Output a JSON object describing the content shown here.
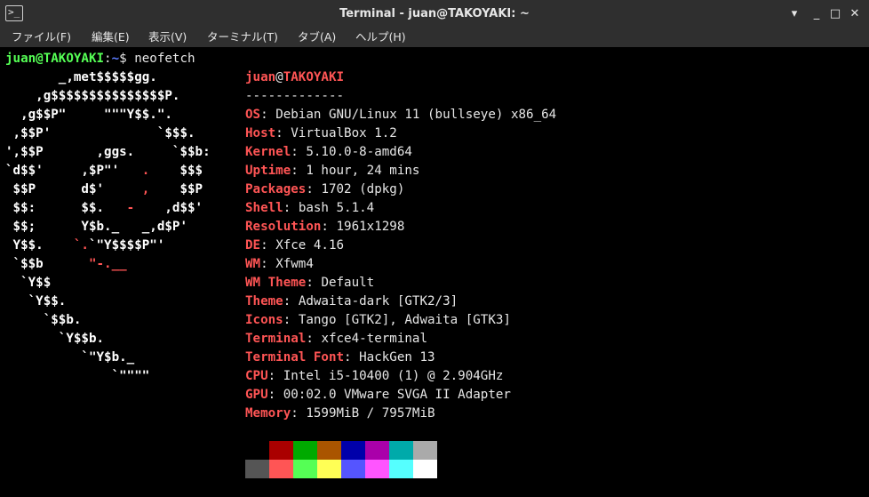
{
  "window": {
    "title": "Terminal - juan@TAKOYAKI: ~",
    "app_icon_glyph": ">_",
    "controls": {
      "minimize": "_",
      "maximize": "□",
      "close": "✕",
      "menu": "▾"
    }
  },
  "menubar": {
    "items": [
      "ファイル(F)",
      "編集(E)",
      "表示(V)",
      "ターミナル(T)",
      "タブ(A)",
      "ヘルプ(H)"
    ]
  },
  "prompt": {
    "user_host": "juan@TAKOYAKI",
    "colon": ":",
    "path": "~",
    "symbol": "$",
    "command": " neofetch"
  },
  "ascii_art": [
    [
      {
        "t": "       _,met$$$$$gg.",
        "c": "w"
      }
    ],
    [
      {
        "t": "    ,g$$$$$$$$$$$$$$$P.",
        "c": "w"
      }
    ],
    [
      {
        "t": "  ,g$$P\"     \"\"\"Y$$.\".",
        "c": "w"
      }
    ],
    [
      {
        "t": " ,$$P'              `$$$.",
        "c": "w"
      }
    ],
    [
      {
        "t": "',$$P       ,ggs.     `$$b:",
        "c": "w"
      }
    ],
    [
      {
        "t": "`d$$'     ,$P\"'   ",
        "c": "w"
      },
      {
        "t": ".",
        "c": "r"
      },
      {
        "t": "    $$$",
        "c": "w"
      }
    ],
    [
      {
        "t": " $$P      d$'     ",
        "c": "w"
      },
      {
        "t": ",",
        "c": "r"
      },
      {
        "t": "    $$P",
        "c": "w"
      }
    ],
    [
      {
        "t": " $$:      $$.   ",
        "c": "w"
      },
      {
        "t": "-",
        "c": "r"
      },
      {
        "t": "    ,d$$'",
        "c": "w"
      }
    ],
    [
      {
        "t": " $$;      Y$b._   _,d$P'",
        "c": "w"
      }
    ],
    [
      {
        "t": " Y$$.    ",
        "c": "w"
      },
      {
        "t": "`.",
        "c": "r"
      },
      {
        "t": "`\"Y$$$$P\"'",
        "c": "w"
      }
    ],
    [
      {
        "t": " `$$b      ",
        "c": "w"
      },
      {
        "t": "\"-.__",
        "c": "r"
      }
    ],
    [
      {
        "t": "  `Y$$",
        "c": "w"
      }
    ],
    [
      {
        "t": "   `Y$$.",
        "c": "w"
      }
    ],
    [
      {
        "t": "     `$$b.",
        "c": "w"
      }
    ],
    [
      {
        "t": "       `Y$$b.",
        "c": "w"
      }
    ],
    [
      {
        "t": "          `\"Y$b._",
        "c": "w"
      }
    ],
    [
      {
        "t": "              `\"\"\"\"",
        "c": "w"
      }
    ]
  ],
  "info": {
    "user": "juan",
    "at": "@",
    "host": "TAKOYAKI",
    "separator": "-------------",
    "fields": [
      {
        "key": "OS",
        "value": "Debian GNU/Linux 11 (bullseye) x86_64"
      },
      {
        "key": "Host",
        "value": "VirtualBox 1.2"
      },
      {
        "key": "Kernel",
        "value": "5.10.0-8-amd64"
      },
      {
        "key": "Uptime",
        "value": "1 hour, 24 mins"
      },
      {
        "key": "Packages",
        "value": "1702 (dpkg)"
      },
      {
        "key": "Shell",
        "value": "bash 5.1.4"
      },
      {
        "key": "Resolution",
        "value": "1961x1298"
      },
      {
        "key": "DE",
        "value": "Xfce 4.16"
      },
      {
        "key": "WM",
        "value": "Xfwm4"
      },
      {
        "key": "WM Theme",
        "value": "Default"
      },
      {
        "key": "Theme",
        "value": "Adwaita-dark [GTK2/3]"
      },
      {
        "key": "Icons",
        "value": "Tango [GTK2], Adwaita [GTK3]"
      },
      {
        "key": "Terminal",
        "value": "xfce4-terminal"
      },
      {
        "key": "Terminal Font",
        "value": "HackGen 13"
      },
      {
        "key": "CPU",
        "value": "Intel i5-10400 (1) @ 2.904GHz"
      },
      {
        "key": "GPU",
        "value": "00:02.0 VMware SVGA II Adapter"
      },
      {
        "key": "Memory",
        "value": "1599MiB / 7957MiB"
      }
    ]
  },
  "palette": {
    "row1": [
      "#000000",
      "#aa0000",
      "#00aa00",
      "#aa5500",
      "#0000aa",
      "#aa00aa",
      "#00aaaa",
      "#aaaaaa"
    ],
    "row2": [
      "#555555",
      "#ff5555",
      "#55ff55",
      "#ffff55",
      "#5555ff",
      "#ff55ff",
      "#55ffff",
      "#ffffff"
    ]
  },
  "colors": {
    "accent_red": "#ff5555",
    "prompt_green": "#55ff55",
    "prompt_blue": "#5c7cff"
  }
}
